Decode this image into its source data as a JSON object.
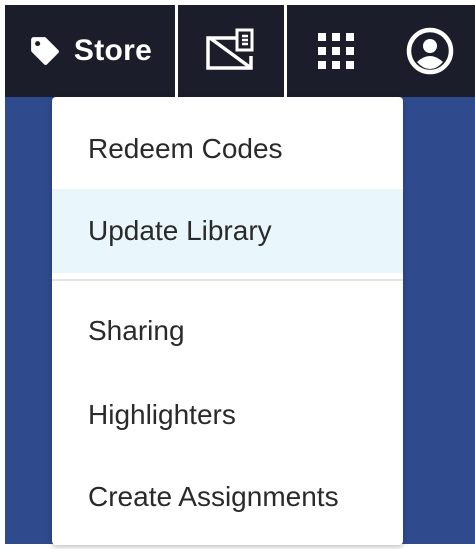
{
  "nav": {
    "store_label": "Store",
    "icons": {
      "store": "tag-icon",
      "bookshelf": "no-book-icon",
      "apps": "grid-apps-icon",
      "account": "account-icon"
    }
  },
  "menu": {
    "items": [
      {
        "label": "Redeem Codes",
        "active": false
      },
      {
        "label": "Update Library",
        "active": true
      },
      {
        "label": "Sharing",
        "active": false
      },
      {
        "label": "Highlighters",
        "active": false
      },
      {
        "label": "Create Assignments",
        "active": false
      }
    ]
  },
  "colors": {
    "topbar": "#1b1d2a",
    "content": "#2f4b8e",
    "active_item": "#e9f6fb"
  }
}
